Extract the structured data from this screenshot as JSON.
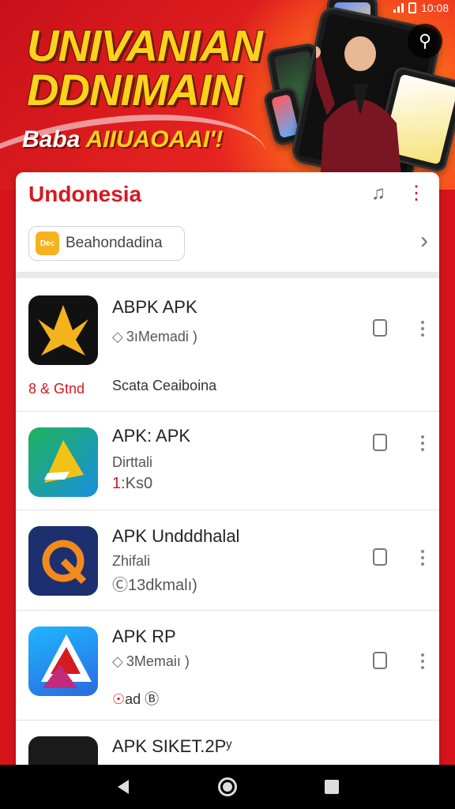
{
  "status_bar": {
    "time": "10:08"
  },
  "banner": {
    "headline_line1": "UNIVANIAN",
    "headline_line2": "DDNIMAIN",
    "tagline_part1": "Baba ",
    "tagline_part2": "AIIUAOAAI'!"
  },
  "card": {
    "title": "Undonesia",
    "chip": {
      "icon_text": "Dec",
      "label": "Beahondadina"
    }
  },
  "apps": [
    {
      "name": "ABPK APK",
      "sub": "3ıMemadi )",
      "extra_left": "8 & Gtnd",
      "extra_text": "Scata  Ceaiboina"
    },
    {
      "name": "APK: APK",
      "sub": "Dirttali",
      "sub2_prefix": "1",
      "sub2": ":Ks0"
    },
    {
      "name": "APK Undddhalal",
      "sub": "Zhifali",
      "sub2": "Ⓒ13dkmalı)"
    },
    {
      "name": "APK RP",
      "sub": "3Memaiı )",
      "extra_left_prefix": "☉",
      "extra_left": "ad Ⓑ"
    },
    {
      "name": "APK SIKET.2Pʸ"
    }
  ],
  "colors": {
    "brand_red": "#d51a22",
    "banner_yellow": "#ffd21c",
    "chip_yellow": "#f7b21f"
  }
}
